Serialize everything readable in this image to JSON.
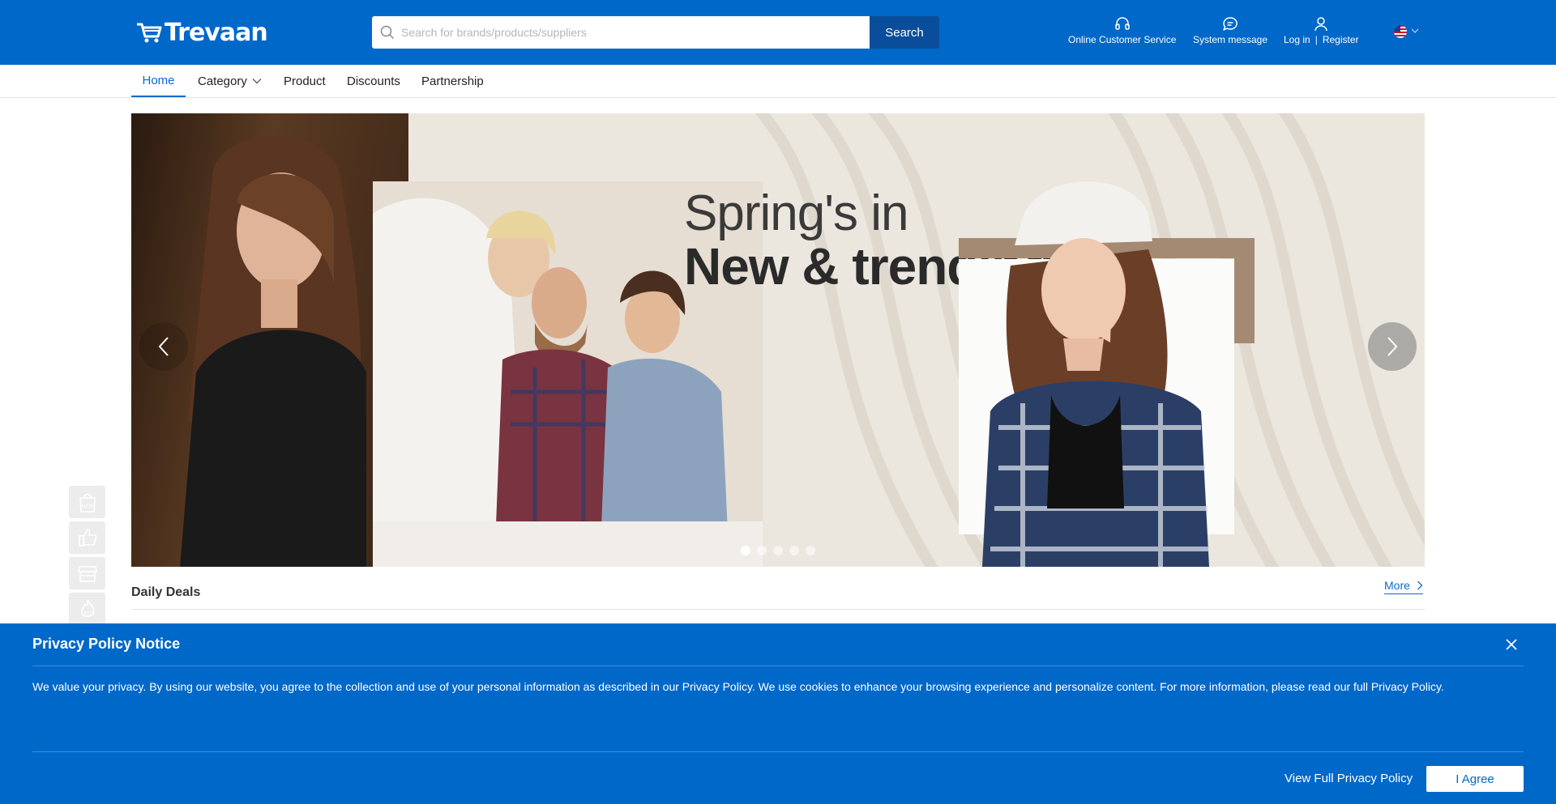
{
  "header": {
    "logo_text": "Trevaan",
    "search": {
      "placeholder": "Search for brands/products/suppliers",
      "value": "",
      "button_label": "Search"
    },
    "links": {
      "customer_service": "Online Customer Service",
      "system_message": "System message",
      "login": "Log in",
      "separator": "|",
      "register": "Register"
    },
    "language_flag": "us-flag-icon"
  },
  "nav": {
    "items": [
      {
        "label": "Home",
        "active": true
      },
      {
        "label": "Category",
        "has_dropdown": true
      },
      {
        "label": "Product"
      },
      {
        "label": "Discounts"
      },
      {
        "label": "Partnership"
      }
    ]
  },
  "banner": {
    "headline_line1": "Spring's in",
    "headline_line2": "New & trending",
    "slide_count": 5,
    "active_slide": 1
  },
  "side_icons": [
    "new-icon",
    "thumbs-up-icon",
    "store-icon",
    "hot-icon"
  ],
  "daily_deals": {
    "title": "Daily Deals",
    "more_label": "More"
  },
  "privacy": {
    "title": "Privacy Policy Notice",
    "text": "We value your privacy. By using our website, you agree to the collection and use of your personal information as described in our Privacy Policy. We use cookies to enhance your browsing experience and personalize content. For more information, please read our full Privacy Policy.",
    "view_link": "View Full Privacy Policy",
    "agree_button": "I Agree"
  },
  "colors": {
    "brand_blue": "#0068c9",
    "search_button": "#0a4d9a",
    "nav_active": "#0a6ad0"
  }
}
